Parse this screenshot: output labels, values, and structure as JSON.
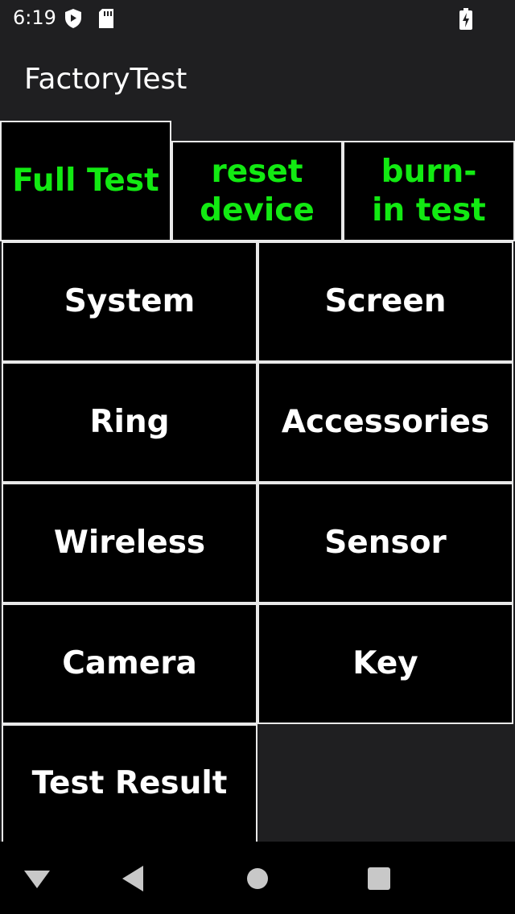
{
  "status_bar": {
    "time": "6:19",
    "icons": [
      "shield-icon",
      "sd-card-icon",
      "battery-charging-icon"
    ]
  },
  "app_bar": {
    "title": "FactoryTest"
  },
  "top_buttons": [
    {
      "label": "Full Test"
    },
    {
      "label": "reset device"
    },
    {
      "label": "burn-in test"
    }
  ],
  "grid_buttons": [
    {
      "label": "System"
    },
    {
      "label": "Screen"
    },
    {
      "label": "Ring"
    },
    {
      "label": "Accessories"
    },
    {
      "label": "Wireless"
    },
    {
      "label": "Sensor"
    },
    {
      "label": "Camera"
    },
    {
      "label": "Key"
    },
    {
      "label": "Test Result"
    }
  ],
  "nav_bar": {
    "icons": [
      "collapse-triangle-icon",
      "back-icon",
      "home-icon",
      "recents-icon"
    ]
  },
  "colors": {
    "background": "#1f1f21",
    "button_bg": "#000000",
    "button_border": "#e9e9e9",
    "accent_green": "#12ea12",
    "text_white": "#ffffff"
  }
}
